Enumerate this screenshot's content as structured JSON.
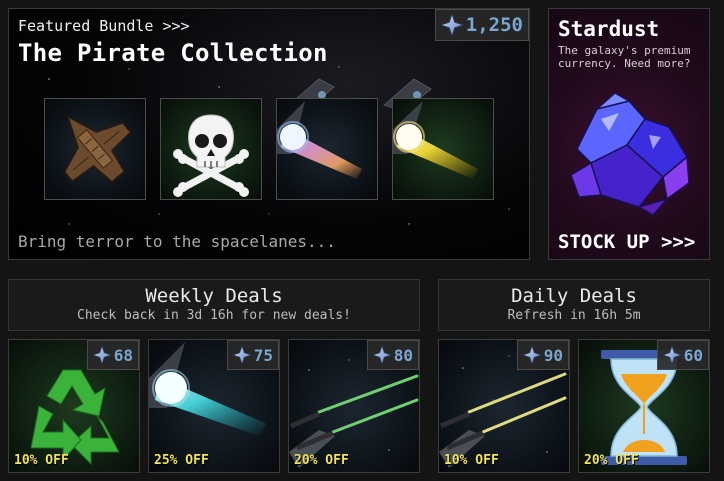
{
  "featured": {
    "kicker": "Featured Bundle >>>",
    "title": "The Pirate Collection",
    "tagline": "Bring terror to the spacelanes...",
    "price": "1,250",
    "items": [
      {
        "name": "pirate-ship",
        "icon": "pirate-ship-icon"
      },
      {
        "name": "skull-crossbones",
        "icon": "skull-crossbones-icon"
      },
      {
        "name": "rainbow-trail",
        "icon": "rainbow-comet-icon"
      },
      {
        "name": "gold-trail",
        "icon": "gold-comet-icon"
      }
    ]
  },
  "stardust": {
    "title": "Stardust",
    "description": "The galaxy's premium currency. Need more?",
    "cta": "STOCK UP >>>"
  },
  "weekly": {
    "title": "Weekly Deals",
    "subtitle": "Check back in 3d 16h for new deals!",
    "items": [
      {
        "price": "68",
        "discount": "10% OFF",
        "icon": "recycle-icon"
      },
      {
        "price": "75",
        "discount": "25% OFF",
        "icon": "cyan-comet-icon"
      },
      {
        "price": "80",
        "discount": "20% OFF",
        "icon": "green-laser-icon"
      }
    ]
  },
  "daily": {
    "title": "Daily Deals",
    "subtitle": "Refresh in 16h 5m",
    "items": [
      {
        "price": "90",
        "discount": "10% OFF",
        "icon": "yellow-laser-icon"
      },
      {
        "price": "60",
        "discount": "20% OFF",
        "icon": "hourglass-icon"
      }
    ]
  },
  "colors": {
    "price_text": "#7aa6d2",
    "discount_text": "#f0e25a",
    "stardust_bg": "#200a1c"
  }
}
